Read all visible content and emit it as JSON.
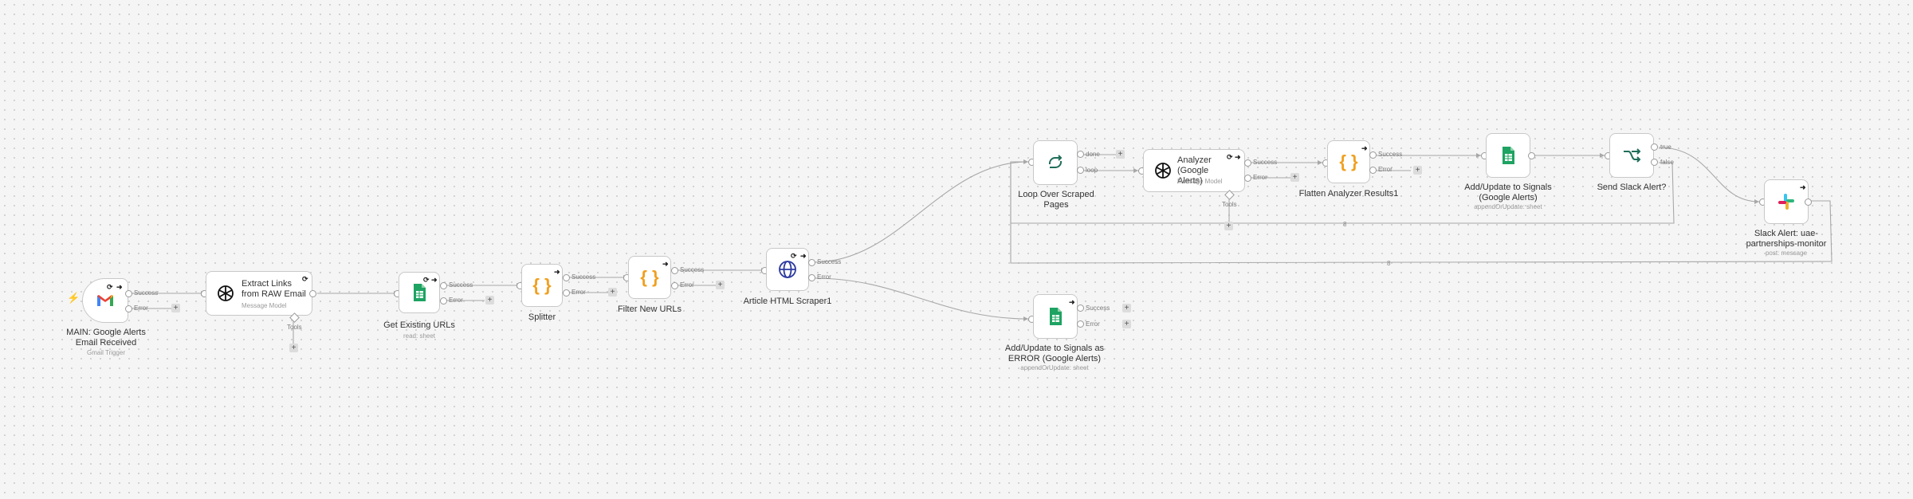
{
  "nodes": {
    "gmail": {
      "title": "MAIN: Google Alerts Email Received",
      "subtitle": "Gmail Trigger",
      "icon": "gmail-icon"
    },
    "extract": {
      "title": "Extract Links from RAW Email",
      "subtitle": "Message Model",
      "icon": "openai-icon"
    },
    "get_urls": {
      "title": "Get Existing URLs",
      "subtitle": "read: sheet",
      "icon": "google-sheets-icon"
    },
    "splitter": {
      "title": "Splitter",
      "icon": "code-braces-icon"
    },
    "filter": {
      "title": "Filter New URLs",
      "icon": "code-braces-icon"
    },
    "scraper": {
      "title": "Article HTML Scraper1",
      "icon": "globe-icon"
    },
    "loop": {
      "title": "Loop Over Scraped Pages",
      "icon": "loop-icon"
    },
    "analyzer": {
      "title": "Analyzer (Google Alerts)",
      "subtitle": "Message Model",
      "icon": "openai-icon"
    },
    "flatten": {
      "title": "Flatten Analyzer Results1",
      "icon": "code-braces-icon"
    },
    "add_update": {
      "title": "Add/Update to Signals (Google Alerts)",
      "subtitle": "appendOrUpdate: sheet",
      "icon": "google-sheets-icon"
    },
    "send_slack": {
      "title": "Send Slack Alert?",
      "icon": "if-branch-icon"
    },
    "slack_alert": {
      "title": "Slack Alert: uae-partnerships-monitor",
      "subtitle": "post: message",
      "icon": "slack-icon"
    },
    "error_sheet": {
      "title": "Add/Update to Signals as ERROR (Google Alerts)",
      "subtitle": "appendOrUpdate: sheet",
      "icon": "google-sheets-icon"
    }
  },
  "ports": {
    "success": "Success",
    "error": "Error",
    "tools": "Tools",
    "done": "done",
    "loop": "loop",
    "true": "true",
    "false": "false"
  },
  "plus_symbol": "+",
  "arrow_symbol": "➜",
  "refresh_symbol": "⟳",
  "loop_edge_count": "8",
  "colors": {
    "background": "#f5f5f5",
    "edge": "#a8a8a8",
    "sheets_green": "#1ea362",
    "code_orange": "#f0a020",
    "loop_teal": "#1f6d5a",
    "globe_blue": "#2d3aa0",
    "trigger_bolt": "#f59a23"
  }
}
